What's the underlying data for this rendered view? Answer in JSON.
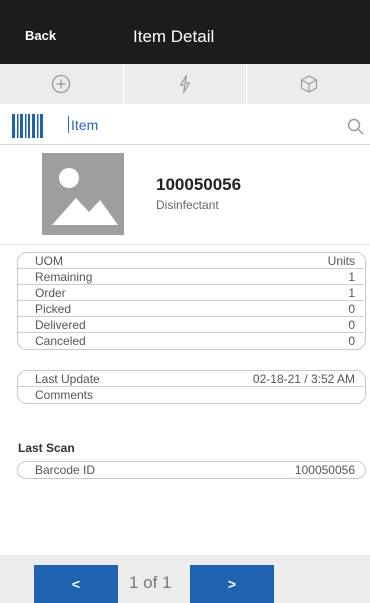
{
  "header": {
    "back_label": "Back",
    "title": "Item Detail"
  },
  "toolbar": {
    "icons": [
      "plus-circle-icon",
      "lightning-icon",
      "cube-icon"
    ]
  },
  "search": {
    "value": "Item",
    "icon": "search-icon"
  },
  "item": {
    "id": "100050056",
    "description": "Disinfectant",
    "image_icon": "image-placeholder-icon"
  },
  "quantities": [
    {
      "label": "UOM",
      "value": "Units"
    },
    {
      "label": "Remaining",
      "value": "1"
    },
    {
      "label": "Order",
      "value": "1"
    },
    {
      "label": "Picked",
      "value": "0"
    },
    {
      "label": "Delivered",
      "value": "0"
    },
    {
      "label": "Canceled",
      "value": "0"
    }
  ],
  "meta": [
    {
      "label": "Last Update",
      "value": "02-18-21 / 3:52 AM"
    },
    {
      "label": "Comments",
      "value": ""
    }
  ],
  "last_scan": {
    "title": "Last Scan",
    "rows": [
      {
        "label": "Barcode ID",
        "value": "100050056"
      }
    ]
  },
  "pager": {
    "prev_label": "<",
    "text": "1 of 1",
    "next_label": ">"
  },
  "colors": {
    "header_bg": "#1c1c1c",
    "accent": "#1f62b0",
    "toolbar_bg": "#ececec"
  }
}
